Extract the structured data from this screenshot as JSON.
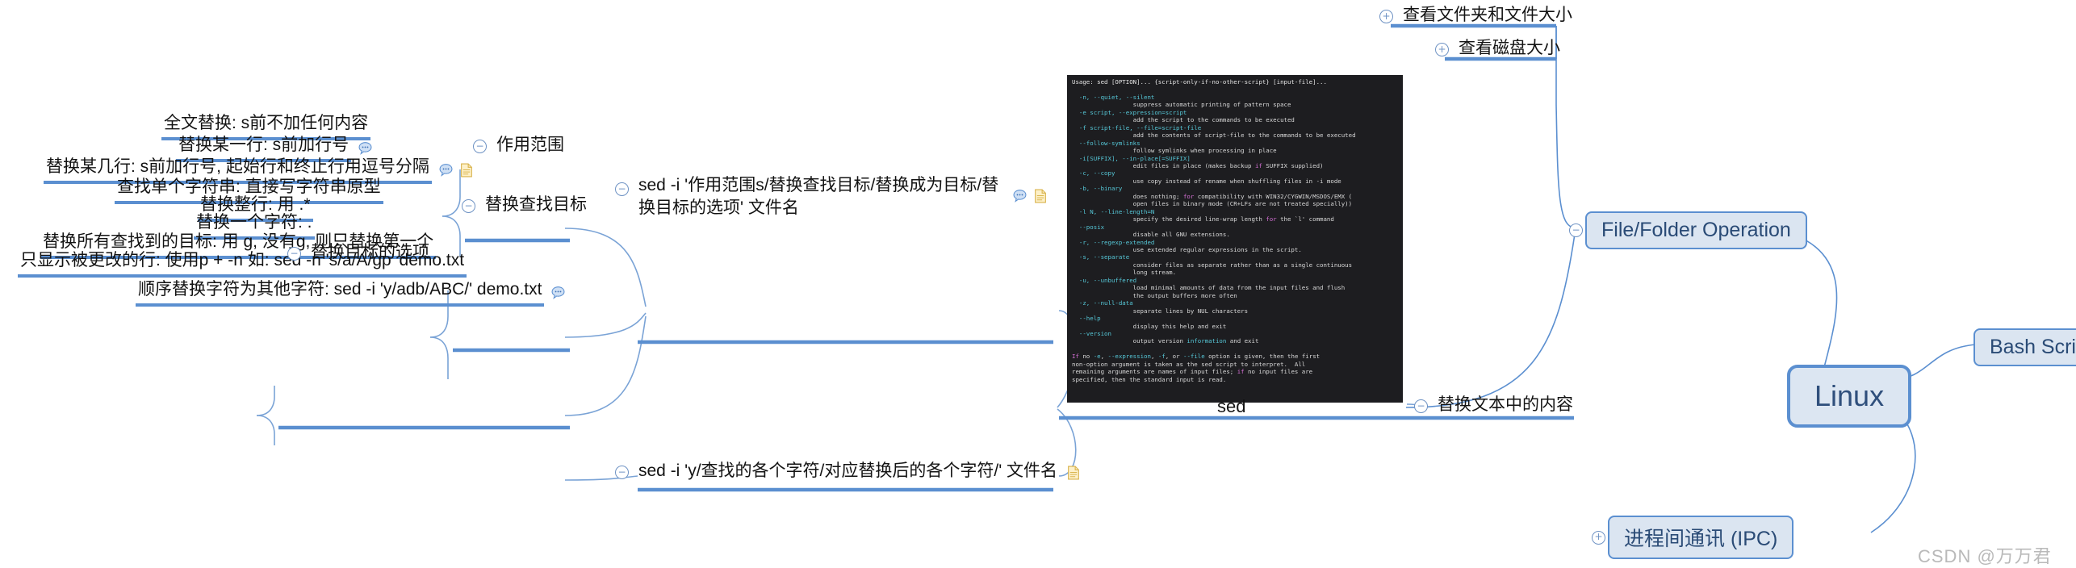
{
  "root": {
    "label": "Linux"
  },
  "branches": {
    "bash_script": {
      "label": "Bash Script",
      "toggle": "+"
    },
    "ipc": {
      "label": "进程间通讯 (IPC)",
      "toggle": "+"
    },
    "file_folder": {
      "label": "File/Folder Operation",
      "toggle": "−"
    }
  },
  "file_folder_children": [
    {
      "label": "查看文件夹和文件大小",
      "toggle": "+"
    },
    {
      "label": "查看磁盘大小",
      "toggle": "+"
    }
  ],
  "text_replace": {
    "label": "替换文本中的内容",
    "toggle": "−"
  },
  "sed": {
    "caption": "sed",
    "terminal_lines": [
      "Usage: sed [OPTION]... {script-only-if-no-other-script} [input-file]...",
      "",
      "  -n, --quiet, --silent",
      "                 suppress automatic printing of pattern space",
      "  -e script, --expression=script",
      "                 add the script to the commands to be executed",
      "  -f script-file, --file=script-file",
      "                 add the contents of script-file to the commands to be executed",
      "  --follow-symlinks",
      "                 follow symlinks when processing in place",
      "  -i[SUFFIX], --in-place[=SUFFIX]",
      "                 edit files in place (makes backup if SUFFIX supplied)",
      "  -c, --copy",
      "                 use copy instead of rename when shuffling files in -i mode",
      "  -b, --binary",
      "                 does nothing; for compatibility with WIN32/CYGWIN/MSDOS/EMX (",
      "                 open files in binary mode (CR+LFs are not treated specially))",
      "  -l N, --line-length=N",
      "                 specify the desired line-wrap length for the `l' command",
      "  --posix",
      "                 disable all GNU extensions.",
      "  -r, --regexp-extended",
      "                 use extended regular expressions in the script.",
      "  -s, --separate",
      "                 consider files as separate rather than as a single continuous",
      "                 long stream.",
      "  -u, --unbuffered",
      "                 load minimal amounts of data from the input files and flush",
      "                 the output buffers more often",
      "  -z, --null-data",
      "                 separate lines by NUL characters",
      "  --help",
      "                 display this help and exit",
      "  --version",
      "                 output version information and exit",
      "",
      "If no -e, --expression, -f, or --file option is given, then the first",
      "non-option argument is taken as the sed script to interpret.  All",
      "remaining arguments are names of input files; if no input files are",
      "specified, then the standard input is read."
    ]
  },
  "sed_command_substitute": {
    "label": "sed -i '作用范围s/替换查找目标/替换成为目标/替换目标的选项' 文件名",
    "toggle": "−",
    "icons": [
      "comment-icon",
      "note-icon"
    ]
  },
  "sed_command_transliterate": {
    "label": "sed -i 'y/查找的各个字符/对应替换后的各个字符/' 文件名",
    "toggle": "−",
    "icons": [
      "note-icon"
    ]
  },
  "scope": {
    "label": "作用范围",
    "toggle": "−",
    "children": [
      {
        "label": "全文替换: s前不加任何内容",
        "icons": []
      },
      {
        "label": "替换某一行: s前加行号",
        "icons": [
          "comment-icon"
        ]
      },
      {
        "label": "替换某几行: s前加行号, 起始行和终止行用逗号分隔",
        "icons": [
          "comment-icon",
          "note-icon"
        ]
      }
    ]
  },
  "find_target": {
    "label": "替换查找目标",
    "toggle": "−",
    "children": [
      {
        "label": "查找单个字符串: 直接写字符串原型",
        "icons": []
      },
      {
        "label": "替换整行: 用 .*",
        "icons": []
      },
      {
        "label": "替换一个字符: .",
        "icons": []
      }
    ]
  },
  "target_options": {
    "label": "替换目标的选项",
    "toggle": "−",
    "children": [
      {
        "label": "替换所有查找到的目标: 用 g, 没有g, 则只替换第一个",
        "icons": []
      },
      {
        "label": "只显示被更改的行: 使用p + -n 如: sed -n 's/a/A/gp' demo.txt",
        "icons": []
      }
    ]
  },
  "transliterate_child": {
    "label": "顺序替换字符为其他字符: sed -i 'y/adb/ABC/' demo.txt",
    "icons": [
      "comment-icon"
    ]
  },
  "watermark": {
    "text": "CSDN @万万君"
  },
  "colors": {
    "branch_line": "#5b8fd0",
    "box_fill": "#dbe5f1",
    "box_border": "#5b8fd0",
    "box_text": "#2a4b76",
    "curve": "#5b8fd0",
    "terminal_bg": "#1d1d20"
  }
}
